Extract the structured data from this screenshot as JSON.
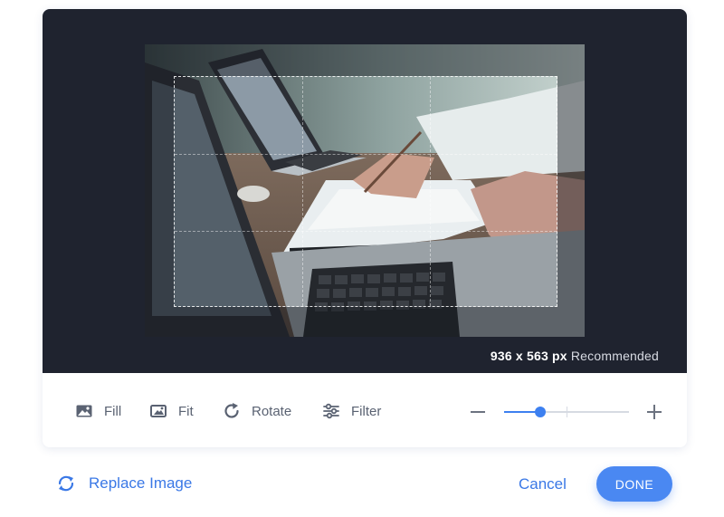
{
  "stage": {
    "dimensions": "936 x 563 px",
    "recommended": "Recommended"
  },
  "toolbar": {
    "fill_label": "Fill",
    "fit_label": "Fit",
    "rotate_label": "Rotate",
    "filter_label": "Filter",
    "zoom_percent": 29
  },
  "footer": {
    "replace_label": "Replace Image",
    "cancel_label": "Cancel",
    "done_label": "DONE"
  },
  "colors": {
    "accent": "#3a78e6",
    "stage_bg": "#1f232f",
    "icon_gray": "#5a6272"
  },
  "icons": [
    "image-fill-icon",
    "image-fit-icon",
    "rotate-icon",
    "filter-sliders-icon",
    "zoom-out-icon",
    "zoom-in-icon",
    "refresh-icon"
  ]
}
